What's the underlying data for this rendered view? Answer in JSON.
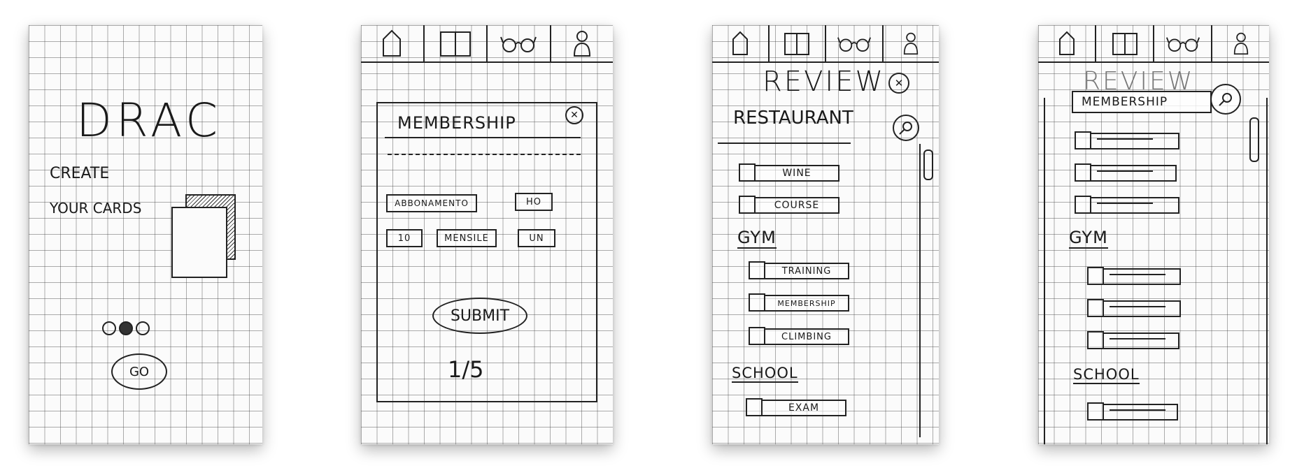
{
  "screen1": {
    "logo": "DRAC",
    "headline_line1": "CREATE",
    "headline_line2": "YOUR CARDS",
    "go_label": "GO"
  },
  "screen2": {
    "title": "MEMBERSHIP",
    "chips_row1": [
      "ABBONAMENTO",
      "HO"
    ],
    "chips_row2": [
      "10",
      "MENSILE",
      "UN"
    ],
    "submit_label": "SUBMIT",
    "page_indicator": "1/5"
  },
  "screen3": {
    "title": "REVIEW",
    "search_heading": "RESTAURANT",
    "sections": [
      {
        "label": "",
        "items": [
          "WINE",
          "COURSE"
        ]
      },
      {
        "label": "GYM",
        "items": [
          "TRAINING",
          "MEMBERSHIP",
          "CLIMBING"
        ]
      },
      {
        "label": "SCHOOL",
        "items": [
          "EXAM"
        ]
      }
    ]
  },
  "screen4": {
    "title": "REVIEW",
    "search_heading": "MEMBERSHIP",
    "section_gym": "GYM",
    "section_school": "SCHOOL"
  }
}
